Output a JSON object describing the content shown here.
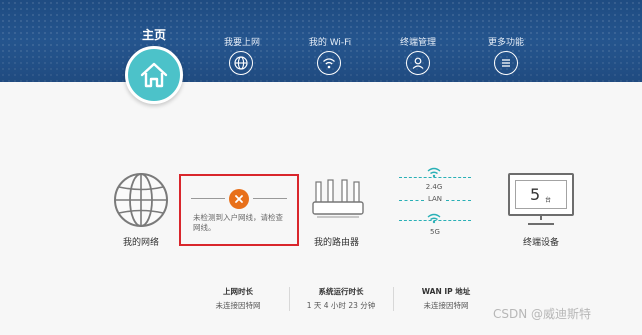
{
  "header": {
    "home_label": "主页",
    "nav": [
      {
        "label": "我要上网",
        "icon": "globe-icon"
      },
      {
        "label": "我的 Wi-Fi",
        "icon": "wifi-icon"
      },
      {
        "label": "终端管理",
        "icon": "user-icon"
      },
      {
        "label": "更多功能",
        "icon": "menu-icon"
      }
    ],
    "colors": {
      "bar": "#2a5d99",
      "home": "#4cc2c9"
    }
  },
  "topology": {
    "network_label": "我的网络",
    "error_message": "未检测到入户网线，请检查网线。",
    "router_label": "我的路由器",
    "band_24": "2.4G",
    "band_lan": "LAN",
    "band_5": "5G",
    "device_count": "5",
    "device_unit": "台",
    "devices_label": "终端设备",
    "colors": {
      "error_border": "#d9262c",
      "error_icon": "#e8701a",
      "wifi": "#29b0b6"
    }
  },
  "stats": [
    {
      "title": "上网时长",
      "value": "未连接因特网"
    },
    {
      "title": "系统运行时长",
      "value": "1 天 4 小时 23 分钟"
    },
    {
      "title": "WAN IP 地址",
      "value": "未连接因特网"
    }
  ],
  "watermark": "CSDN @威迪斯特"
}
